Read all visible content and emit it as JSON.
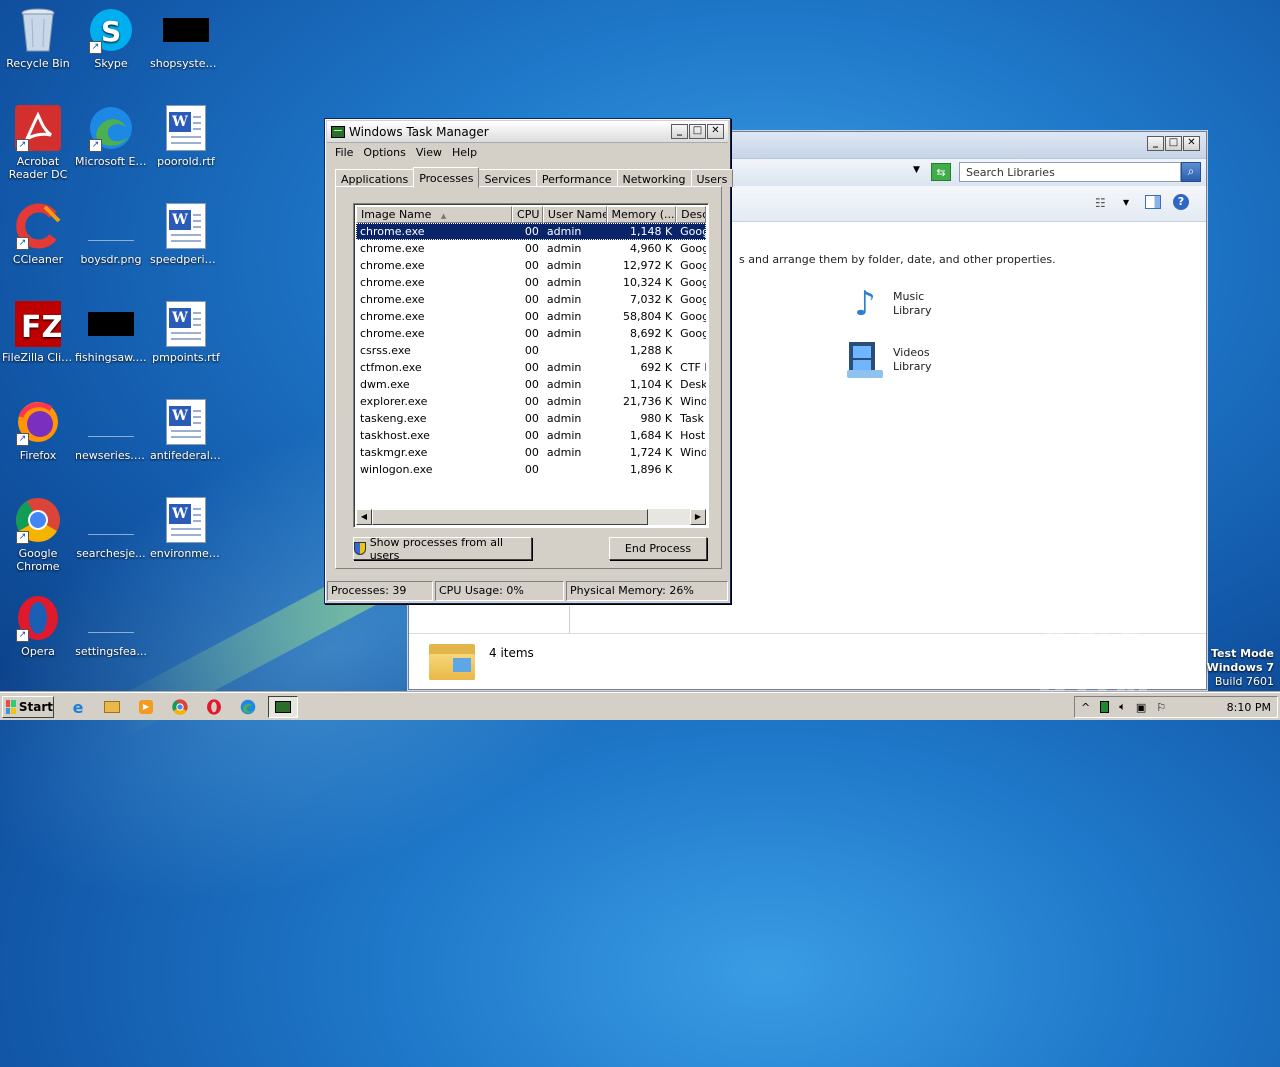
{
  "desktop": {
    "icons": [
      {
        "label": "Recycle Bin"
      },
      {
        "label": "Skype"
      },
      {
        "label": "shopsystem..."
      },
      {
        "label": "Acrobat Reader DC"
      },
      {
        "label": "Microsoft Edge"
      },
      {
        "label": "poorold.rtf"
      },
      {
        "label": "CCleaner"
      },
      {
        "label": "boysdr.png"
      },
      {
        "label": "speedperiod..."
      },
      {
        "label": "FileZilla Client"
      },
      {
        "label": "fishingsaw.jpg"
      },
      {
        "label": "pmpoints.rtf"
      },
      {
        "label": "Firefox"
      },
      {
        "label": "newseries.png"
      },
      {
        "label": "antifederal.rtf"
      },
      {
        "label": "Google Chrome"
      },
      {
        "label": "searchesje..."
      },
      {
        "label": "environmen..."
      },
      {
        "label": "Opera"
      },
      {
        "label": "settingsfea..."
      }
    ]
  },
  "explorer": {
    "search_placeholder": "Search Libraries",
    "hint": "s and arrange them by folder, date, and other properties.",
    "libraries": [
      {
        "line1": "Music",
        "line2": "Library"
      },
      {
        "line1": "Videos",
        "line2": "Library"
      }
    ],
    "status": "4 items"
  },
  "taskmgr": {
    "title": "Windows Task Manager",
    "menu": [
      "File",
      "Options",
      "View",
      "Help"
    ],
    "tabs": [
      "Applications",
      "Processes",
      "Services",
      "Performance",
      "Networking",
      "Users"
    ],
    "active_tab": "Processes",
    "columns": [
      "Image Name",
      "CPU",
      "User Name",
      "Memory (...",
      "Desc"
    ],
    "rows": [
      {
        "name": "chrome.exe",
        "cpu": "00",
        "user": "admin",
        "mem": "1,148 K",
        "desc": "Goog"
      },
      {
        "name": "chrome.exe",
        "cpu": "00",
        "user": "admin",
        "mem": "4,960 K",
        "desc": "Goog"
      },
      {
        "name": "chrome.exe",
        "cpu": "00",
        "user": "admin",
        "mem": "12,972 K",
        "desc": "Goog"
      },
      {
        "name": "chrome.exe",
        "cpu": "00",
        "user": "admin",
        "mem": "10,324 K",
        "desc": "Goog"
      },
      {
        "name": "chrome.exe",
        "cpu": "00",
        "user": "admin",
        "mem": "7,032 K",
        "desc": "Goog"
      },
      {
        "name": "chrome.exe",
        "cpu": "00",
        "user": "admin",
        "mem": "58,804 K",
        "desc": "Goog"
      },
      {
        "name": "chrome.exe",
        "cpu": "00",
        "user": "admin",
        "mem": "8,692 K",
        "desc": "Goog"
      },
      {
        "name": "csrss.exe",
        "cpu": "00",
        "user": "",
        "mem": "1,288 K",
        "desc": ""
      },
      {
        "name": "ctfmon.exe",
        "cpu": "00",
        "user": "admin",
        "mem": "692 K",
        "desc": "CTF I"
      },
      {
        "name": "dwm.exe",
        "cpu": "00",
        "user": "admin",
        "mem": "1,104 K",
        "desc": "Desk"
      },
      {
        "name": "explorer.exe",
        "cpu": "00",
        "user": "admin",
        "mem": "21,736 K",
        "desc": "Wind"
      },
      {
        "name": "taskeng.exe",
        "cpu": "00",
        "user": "admin",
        "mem": "980 K",
        "desc": "Task"
      },
      {
        "name": "taskhost.exe",
        "cpu": "00",
        "user": "admin",
        "mem": "1,684 K",
        "desc": "Host"
      },
      {
        "name": "taskmgr.exe",
        "cpu": "00",
        "user": "admin",
        "mem": "1,724 K",
        "desc": "Wind"
      },
      {
        "name": "winlogon.exe",
        "cpu": "00",
        "user": "",
        "mem": "1,896 K",
        "desc": ""
      }
    ],
    "show_all_button": "Show processes from all users",
    "end_process_button": "End Process",
    "status_processes": "Processes: 39",
    "status_cpu": "CPU Usage: 0%",
    "status_memory": "Physical Memory: 26%"
  },
  "taskbar": {
    "start_label": "Start",
    "clock": "8:10 PM"
  },
  "watermark": {
    "line1": "Test Mode",
    "line2": "Windows 7",
    "line3": "Build 7601",
    "brand": "ANY RUN"
  }
}
